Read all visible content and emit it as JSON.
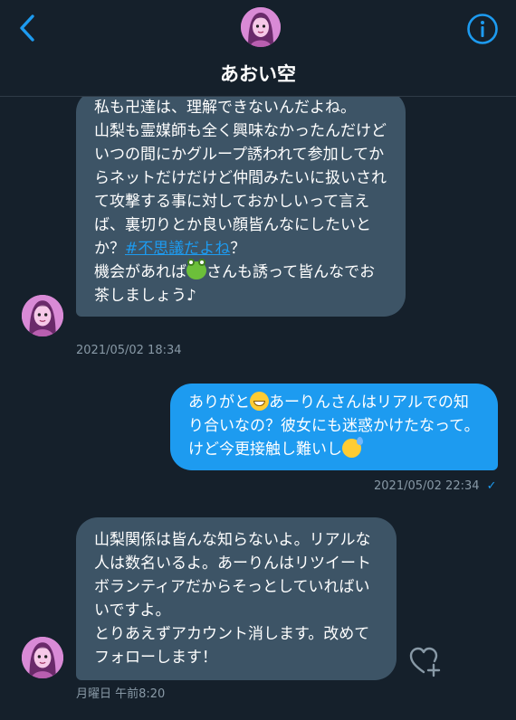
{
  "header": {
    "title": "あおい空",
    "back_icon": "chevron-left-icon",
    "info_icon": "info-icon",
    "accent_color": "#1d9bf0"
  },
  "messages": [
    {
      "direction": "incoming",
      "text_before_hashtag": "私も卍達は、理解できないんだよね。\n山梨も霊媒師も全く興味なかったんだけどいつの間にかグループ誘われて参加してからネットだけだけど仲間みたいに扱いされて攻撃する事に対しておかしいって言えば、裏切りとか良い顔皆んなにしたいとか？",
      "hashtag": "#不思議だよね",
      "after_hashtag": "？\n機会があれば",
      "emoji": "frog-emoji",
      "text_after_emoji": "さんも誘って皆んなでお茶しましょう♪",
      "timestamp": "2021/05/02 18:34"
    },
    {
      "direction": "outgoing",
      "text_before_emoji": "ありがと",
      "emoji1": "grinning-emoji",
      "text_middle": "あーりんさんはリアルでの知り合いなの？彼女にも迷惑かけたなって。けど今更接触し難いし",
      "emoji2": "downcast-sweat-emoji",
      "timestamp": "2021/05/02 22:34",
      "status_icon": "sent-check-icon",
      "status_text": "✓"
    },
    {
      "direction": "incoming",
      "text": "山梨関係は皆んな知らないよ。リアルな人は数名いるよ。あーりんはリツイートボランティアだからそっとしていればいいですよ。\nとりあえずアカウント消します。改めてフォローします！",
      "timestamp": "月曜日 午前8:20",
      "reaction_icon": "heart-plus-icon"
    }
  ]
}
